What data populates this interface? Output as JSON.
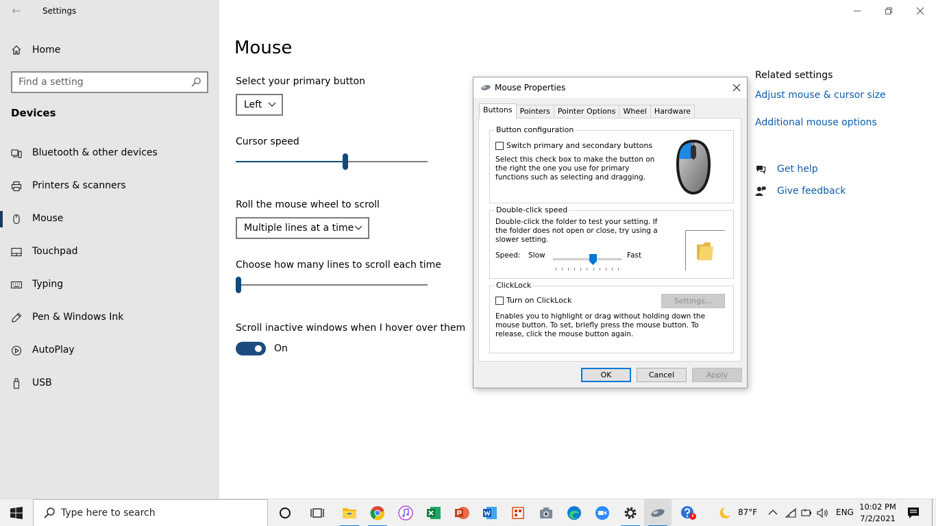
{
  "window": {
    "title": "Settings",
    "back_glyph": "←",
    "controls": [
      "minimize-icon",
      "maximize-icon",
      "close-icon"
    ]
  },
  "sidebar": {
    "home_label": "Home",
    "search_placeholder": "Find a setting",
    "section_title": "Devices",
    "items": [
      {
        "label": "Bluetooth & other devices",
        "icon": "bluetooth-devices-icon",
        "selected": false
      },
      {
        "label": "Printers & scanners",
        "icon": "printer-icon",
        "selected": false
      },
      {
        "label": "Mouse",
        "icon": "mouse-icon",
        "selected": true
      },
      {
        "label": "Touchpad",
        "icon": "touchpad-icon",
        "selected": false
      },
      {
        "label": "Typing",
        "icon": "keyboard-icon",
        "selected": false
      },
      {
        "label": "Pen & Windows Ink",
        "icon": "pen-icon",
        "selected": false
      },
      {
        "label": "AutoPlay",
        "icon": "autoplay-icon",
        "selected": false
      },
      {
        "label": "USB",
        "icon": "usb-icon",
        "selected": false
      }
    ]
  },
  "main": {
    "title": "Mouse",
    "primary_button_label": "Select your primary button",
    "primary_button_value": "Left",
    "cursor_speed_label": "Cursor speed",
    "cursor_speed_level": 0.575,
    "scroll_label": "Roll the mouse wheel to scroll",
    "scroll_value": "Multiple lines at a time",
    "lines_label": "Choose how many lines to scroll each time",
    "lines_level": 0.0,
    "inactive_label": "Scroll inactive windows when I hover over them",
    "inactive_state": "On",
    "inactive_on": true
  },
  "related": {
    "title": "Related settings",
    "links": [
      "Adjust mouse & cursor size",
      "Additional mouse options"
    ],
    "help": "Get help",
    "feedback": "Give feedback"
  },
  "dialog": {
    "title": "Mouse Properties",
    "tabs": [
      "Buttons",
      "Pointers",
      "Pointer Options",
      "Wheel",
      "Hardware"
    ],
    "active_tab": "Buttons",
    "button_config": {
      "title": "Button configuration",
      "checkbox": "Switch primary and secondary buttons",
      "checked": false,
      "description": "Select this check box to make the button on the right the one you use for primary functions such as selecting and dragging."
    },
    "double_click": {
      "title": "Double-click speed",
      "description": "Double-click the folder to test your setting. If the folder does not open or close, try using a slower setting.",
      "speed_label": "Speed:",
      "slow_label": "Slow",
      "fast_label": "Fast",
      "speed_level": 0.6
    },
    "clicklock": {
      "title": "ClickLock",
      "checkbox": "Turn on ClickLock",
      "checked": false,
      "settings_button": "Settings...",
      "description": "Enables you to highlight or drag without holding down the mouse button. To set, briefly press the mouse button. To release, click the mouse button again."
    },
    "buttons": {
      "ok": "OK",
      "cancel": "Cancel",
      "apply": "Apply"
    }
  },
  "taskbar": {
    "search_placeholder": "Type here to search",
    "apps": [
      "cortana-icon",
      "task-view-icon",
      "file-explorer-icon",
      "chrome-icon",
      "itunes-icon",
      "excel-icon",
      "powerpoint-icon",
      "word-icon",
      "office-icon",
      "camera-icon",
      "edge-icon",
      "zoom-icon",
      "settings-icon",
      "mouse-app-icon",
      "help-icon"
    ],
    "weather": "87°F",
    "language": "ENG",
    "time": "10:02 PM",
    "date": "7/2/2021"
  },
  "colors": {
    "accent": "#0f4b7a",
    "link": "#0b5cad",
    "sidebar_bg": "#e6e6e6",
    "windows_blue": "#0078d7"
  }
}
